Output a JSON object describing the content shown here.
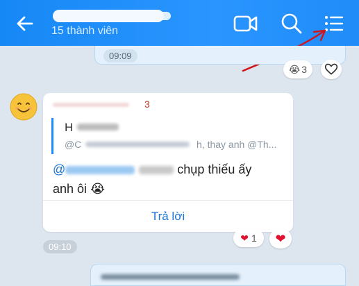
{
  "header": {
    "title": "",
    "subtitle": "15 thành viên",
    "icons": {
      "back": "arrow-left-icon",
      "video": "video-camera-icon",
      "search": "search-icon",
      "menu": "list-menu-icon"
    },
    "colors": {
      "bar": "#1f8cf8",
      "icon": "#ffffff"
    }
  },
  "annotation": {
    "arrow_color": "#d0161e"
  },
  "previous_message": {
    "time": "09:09"
  },
  "reactions_previous": {
    "cry_count": "3"
  },
  "message": {
    "sender_suffix": "3",
    "quote_name": "H",
    "quote_snippet": "@C",
    "quote_tail": "h, thay anh @Th...",
    "mention": "@",
    "body_visible_1": "chụp thiếu ấy",
    "body_visible_2": "anh ôi",
    "reply_label": "Trả lời",
    "time": "09:10"
  },
  "reactions_message": {
    "heart_count": "1"
  },
  "colors": {
    "background": "#dde5ee",
    "sender_name": "#c0392b",
    "link": "#1a74d6",
    "quote_bar": "#1a8cff"
  }
}
